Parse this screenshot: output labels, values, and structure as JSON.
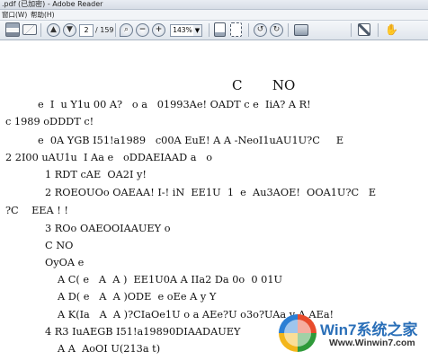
{
  "window": {
    "title": ".pdf (已加密) - Adobe Reader"
  },
  "menu": {
    "items": [
      "窗口(W)",
      "帮助(H)"
    ]
  },
  "toolbar": {
    "page_current": "2",
    "page_total": "/ 159",
    "zoom": "143%",
    "icons": [
      "print-icon",
      "email-icon",
      "page-up-icon",
      "page-down-icon",
      "select-zoom-icon",
      "zoom-out-icon",
      "zoom-in-icon",
      "single-page-icon",
      "fit-page-icon",
      "rotate-ccw-icon",
      "rotate-cw-icon",
      "snapshot-icon",
      "fullscreen-icon",
      "hand-icon"
    ]
  },
  "document": {
    "lines": [
      "C       NO",
      "e  I  u Y1u 00 A?   o a   01993Ae! OADT c e  IiA? A R!",
      "c 1989 oDDDT c!",
      "e  0A YGB I51!a1989   c00A EuE! A A -NeoI1uAU1U?C     E",
      "2 2I00 uAU1u  I Aa e   oDDAEIAAD a   o",
      "1 RDT cAE  OA2I y!",
      "2 ROEOUOo OAEAA! I-! iN  EE1U  1  e  Au3AOE!  OOA1U?C   E",
      "?C    EEA ! !",
      "3 ROo OAEOOIAAUEY o",
      "C NO",
      "OyOA e",
      "A C( e   A  A )  EE1U0A A IIa2 Da 0o  0 01U",
      "A D( e   A  A )ODE  e oEe A y Y",
      "A K(Ia   A  A )?CIaOe1U o a AEe?U o3o?UAa y A AEa!",
      "4 R3 IuAEGB I51!a19890DIAADAUEY",
      "A A  AoOI U(213a t)"
    ]
  },
  "watermark": {
    "title": "Win7系统之家",
    "url": "Www.Winwin7.com"
  }
}
